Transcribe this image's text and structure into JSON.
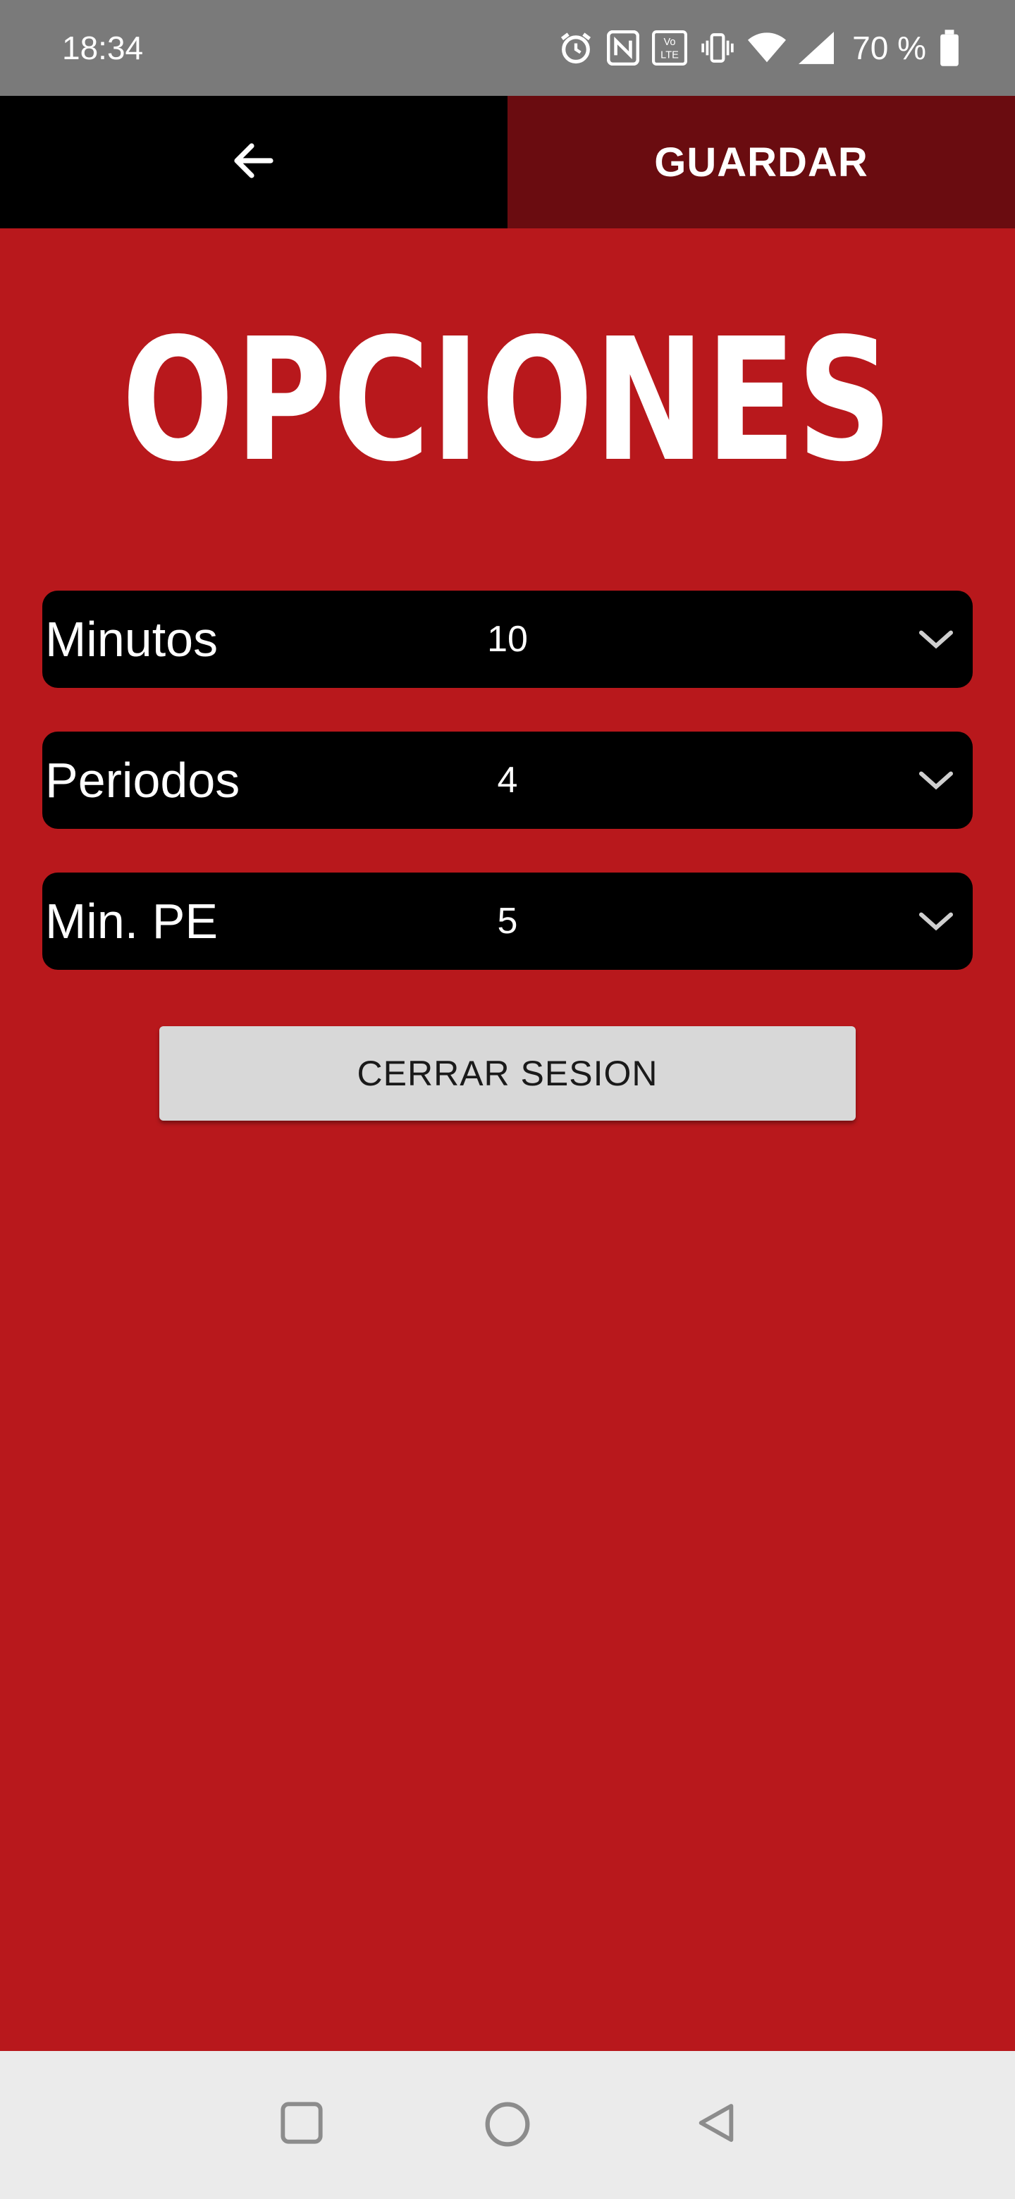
{
  "status_bar": {
    "time": "18:34",
    "battery_text": "70 %",
    "icons": [
      "alarm-icon",
      "nfc-icon",
      "volte-icon",
      "vibrate-icon",
      "wifi-icon",
      "signal-icon",
      "battery-icon"
    ]
  },
  "toolbar": {
    "back_icon": "arrow-left-icon",
    "save_label": "GUARDAR",
    "back_bg": "#000000",
    "save_bg": "#6a0c10"
  },
  "page": {
    "title": "OPCIONES",
    "background": "#b8181c"
  },
  "settings": [
    {
      "label": "Minutos",
      "value": "10"
    },
    {
      "label": "Periodos",
      "value": "4"
    },
    {
      "label": "Min. PE",
      "value": "5"
    }
  ],
  "logout": {
    "label": "CERRAR SESION"
  },
  "nav": {
    "icons": [
      "recent-apps-icon",
      "home-icon",
      "back-icon"
    ]
  }
}
